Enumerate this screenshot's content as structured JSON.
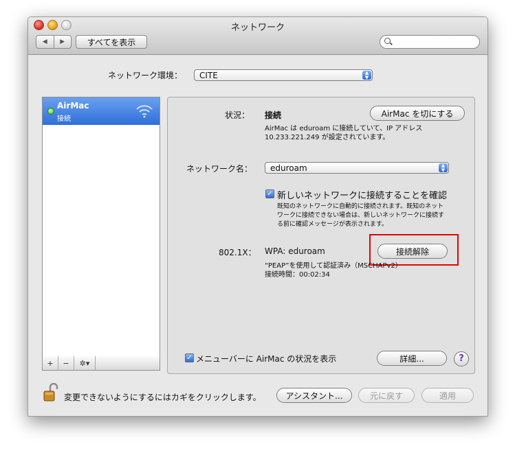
{
  "window": {
    "title": "ネットワーク"
  },
  "toolbar": {
    "show_all_label": "すべてを表示",
    "search_placeholder": ""
  },
  "location": {
    "label": "ネットワーク環境：",
    "value": "CITE"
  },
  "sidebar": {
    "items": [
      {
        "name": "AirMac",
        "status": "接続"
      }
    ],
    "tools": {
      "add": "+",
      "remove": "−",
      "gear": "✲▾"
    }
  },
  "panel": {
    "status_label": "状況：",
    "status_value": "接続",
    "turn_off_button": "AirMac を切にする",
    "status_desc_1": "AirMac は eduroam に接続していて、IP アドレス",
    "status_desc_2": "10.233.221.249 が設定されています。",
    "network_name_label": "ネットワーク名：",
    "network_name_value": "eduroam",
    "ask_join_label": "新しいネットワークに接続することを確認",
    "ask_join_desc_1": "既知のネットワークに自動的に接続されます。既知のネット",
    "ask_join_desc_2": "ワークに接続できない場合は、新しいネットワークに接続す",
    "ask_join_desc_3": "る前に確認メッセージが表示されます。",
    "dot1x_label": "802.1X：",
    "dot1x_value": "WPA: eduroam",
    "disconnect_button": "接続解除",
    "auth_desc": "“PEAP”を使用して認証済み（MSCHAPv2）",
    "connect_time": "接続時間：00:02:34",
    "menubar_label": "メニューバーに AirMac の状況を表示",
    "advanced_button": "詳細...",
    "help": "?"
  },
  "footer": {
    "lock_text": "変更できないようにするにはカギをクリックします。",
    "assistant_button": "アシスタント...",
    "revert_button": "元に戻す",
    "apply_button": "適用"
  },
  "colors": {
    "selection": "#3a78e0",
    "highlight": "#e60000"
  }
}
